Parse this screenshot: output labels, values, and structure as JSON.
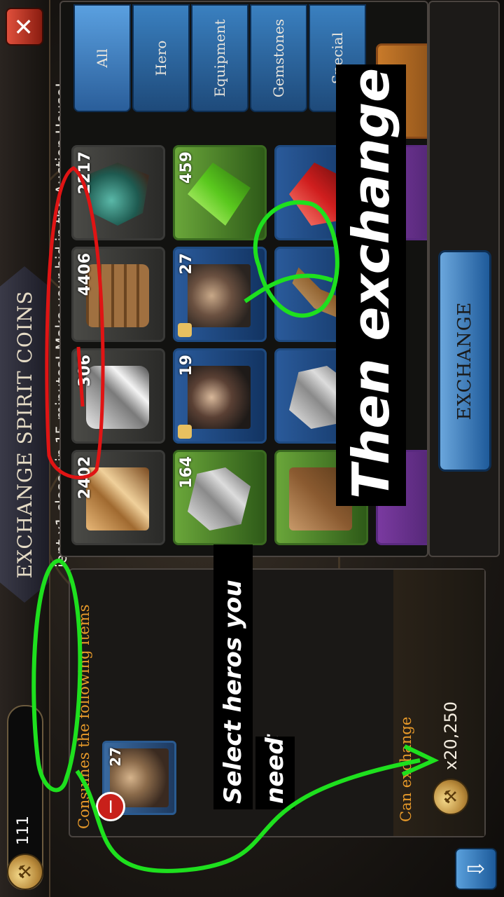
{
  "header": {
    "coin_count": "111",
    "title": "EXCHANGE SPIRIT COINS",
    "close_symbol": "✕",
    "down_symbol": "⇩"
  },
  "marquee": "ient x1 closes in 15 minutes! Make your bid in the Auction House!",
  "left_panel": {
    "consumes_label": "Consumes the following items",
    "consumed_item": {
      "quantity": "27",
      "remove_symbol": "−"
    },
    "can_exchange_label": "Can exchange",
    "reward_value": "x20,250"
  },
  "tabs": [
    {
      "label": "All",
      "active": true
    },
    {
      "label": "Hero",
      "active": false
    },
    {
      "label": "Equipment",
      "active": false
    },
    {
      "label": "Gemstones",
      "active": false
    },
    {
      "label": "Special",
      "active": false
    }
  ],
  "grid": {
    "row1": [
      "2402",
      "306",
      "4406",
      "2217"
    ],
    "row2": [
      "164",
      "19",
      "27",
      "459"
    ]
  },
  "exchange_button": {
    "label": "EXCHANGE"
  },
  "annotations": {
    "then_exchange": "Then exchange",
    "select_line1": "Select heros you don't",
    "select_line2": "need"
  },
  "colors": {
    "annotation_green": "#1ee01e",
    "annotation_red": "#e01414",
    "tab_blue": "#2a6aa8",
    "label_orange": "#e89a2a"
  }
}
